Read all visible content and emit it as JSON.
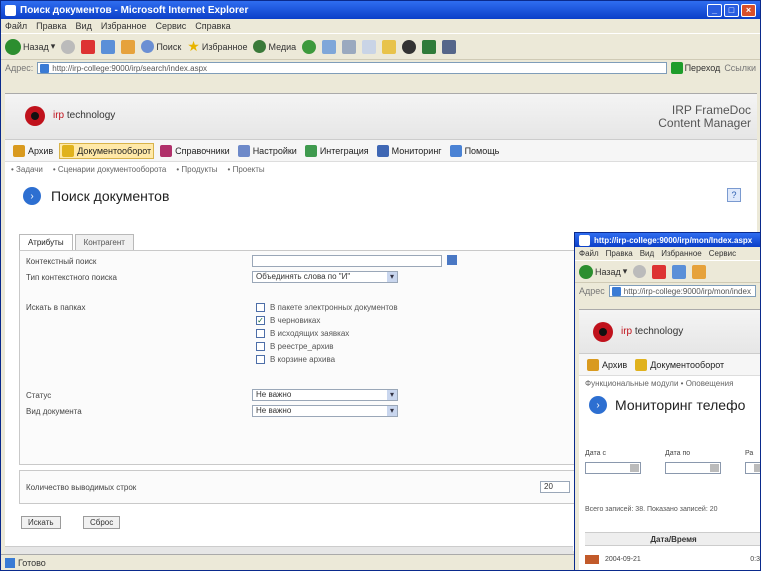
{
  "main_window": {
    "title": "Поиск документов - Microsoft Internet Explorer",
    "menu": [
      "Файл",
      "Правка",
      "Вид",
      "Избранное",
      "Сервис",
      "Справка"
    ],
    "toolbar": {
      "back": "Назад",
      "search": "Поиск",
      "favorites": "Избранное",
      "media": "Медиа"
    },
    "address_label": "Адрес:",
    "address": "http://irp-college:9000/irp/search/index.aspx",
    "go_label": "Переход",
    "links_label": "Ссылки",
    "status": "Готово"
  },
  "app": {
    "brand_prefix": "irp",
    "brand_suffix": "technology",
    "product_line1": "IRP FrameDoc",
    "product_line2": "Content Manager",
    "modules": [
      {
        "label": "Архив",
        "color": "#d99a1f"
      },
      {
        "label": "Документооборот",
        "color": "#e0b21d",
        "active": true
      },
      {
        "label": "Справочники",
        "color": "#b0306a"
      },
      {
        "label": "Настройки",
        "color": "#6d89c9"
      },
      {
        "label": "Интеграция",
        "color": "#3f9a4e"
      },
      {
        "label": "Мониторинг",
        "color": "#3f67b4"
      },
      {
        "label": "Помощь",
        "color": "#4a82d4"
      }
    ],
    "subnav": [
      "Задачи",
      "Сценарии документооборота",
      "Продукты",
      "Проекты"
    ]
  },
  "page": {
    "title": "Поиск документов",
    "help": "?",
    "tabs": [
      "Атрибуты",
      "Контрагент"
    ],
    "fields": {
      "context_label": "Контекстный поиск",
      "context_value": "",
      "mode_label": "Тип контекстного поиска",
      "mode_value": "Объединять слова по \"И\"",
      "where_label": "Искать в папках",
      "status_label": "Статус",
      "status_value": "Не важно",
      "doctype_label": "Вид документа",
      "doctype_value": "Не важно"
    },
    "folders": [
      {
        "label": "В пакете электронных документов",
        "checked": false
      },
      {
        "label": "В черновиках",
        "checked": true
      },
      {
        "label": "В исходящих заявках",
        "checked": false
      },
      {
        "label": "В реестре_архив",
        "checked": false
      },
      {
        "label": "В корзине архива",
        "checked": false
      }
    ],
    "count_label": "Количество выводимых строк",
    "count_value": "20",
    "search_button": "Искать",
    "reset_button": "Сброс"
  },
  "second_window": {
    "title": "http://irp-college:9000/irp/mon/Index.aspx",
    "menu": [
      "Файл",
      "Правка",
      "Вид",
      "Избранное",
      "Сервис"
    ],
    "back": "Назад",
    "address_label": "Адрес",
    "address": "http://irp-college:9000/irp/mon/index",
    "subnav": "Функциональные модули • Оповещения",
    "title_text": "Мониторинг телефо",
    "date_from_label": "Дата с",
    "date_to_label": "Дата по",
    "third_label": "Ра",
    "info": "Всего записей: 38. Показано записей: 20",
    "table_header": "Дата/Время",
    "row_date": "2004-09-21",
    "row_value": "0:3"
  }
}
